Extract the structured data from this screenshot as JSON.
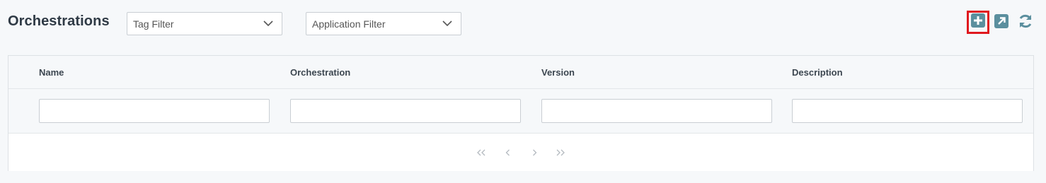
{
  "page": {
    "title": "Orchestrations"
  },
  "filters": {
    "tag": {
      "label": "Tag Filter"
    },
    "application": {
      "label": "Application Filter"
    }
  },
  "toolbar": {
    "icons": [
      "plus-square-icon",
      "external-link-icon",
      "refresh-icon"
    ],
    "accent": "#5b8f9e",
    "highlight": "#e0191e"
  },
  "grid": {
    "columns": [
      {
        "label": "Name",
        "filter_value": ""
      },
      {
        "label": "Orchestration",
        "filter_value": ""
      },
      {
        "label": "Version",
        "filter_value": ""
      },
      {
        "label": "Description",
        "filter_value": ""
      }
    ],
    "rows": []
  },
  "pager": {
    "first": "«",
    "prev": "‹",
    "next": "›",
    "last": "»"
  }
}
